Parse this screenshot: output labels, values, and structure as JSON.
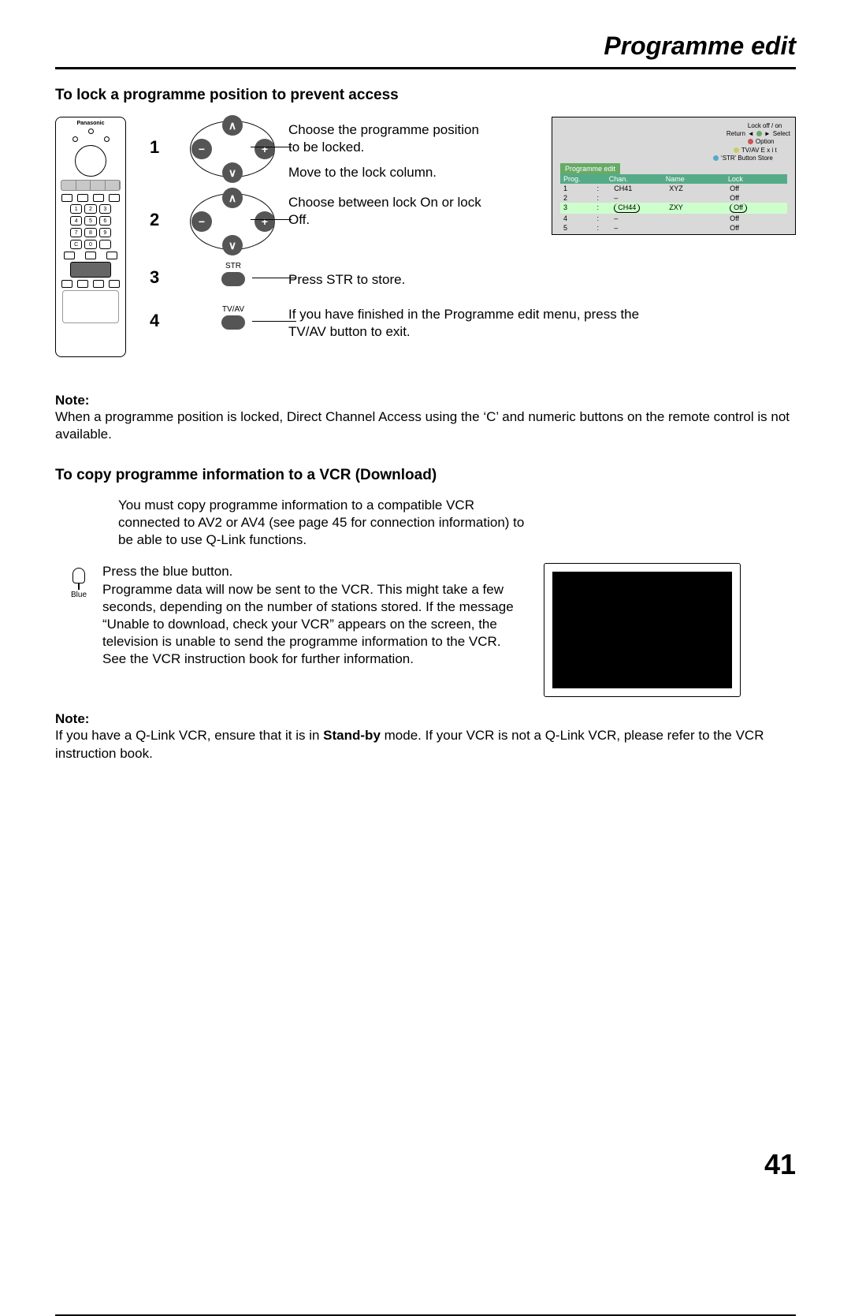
{
  "page_title": "Programme edit",
  "page_number": "41",
  "section1": {
    "title": "To lock a programme position to prevent access",
    "remote_brand": "Panasonic",
    "steps": [
      {
        "num": "1",
        "text1": "Choose the programme position to be locked.",
        "text2": "Move to the lock column."
      },
      {
        "num": "2",
        "text1": "Choose between lock On or lock Off."
      },
      {
        "num": "3",
        "label": "STR",
        "text1": "Press STR to store."
      },
      {
        "num": "4",
        "label": "TV/AV",
        "text1": "If you have finished in the Programme edit menu, press the TV/AV button to exit."
      }
    ],
    "note_label": "Note:",
    "note_text": "When a programme position is locked, Direct Channel Access using the ‘C’ and numeric buttons on the remote control is not available."
  },
  "osd": {
    "menu": {
      "lock": "Lock off / on",
      "select": "Select",
      "return": "Return",
      "option": "Option",
      "exit": "TV/AV    E x i t",
      "store": "‘STR’ Button    Store"
    },
    "tab": "Programme edit",
    "headers": [
      "Prog.",
      "Chan.",
      "Name",
      "Lock"
    ],
    "rows": [
      {
        "cells": [
          "1",
          ":",
          "CH41",
          "XYZ",
          "Off"
        ],
        "sel": false
      },
      {
        "cells": [
          "2",
          ":",
          "–",
          "",
          "Off"
        ],
        "sel": false
      },
      {
        "cells": [
          "3",
          ":",
          "CH44",
          "ZXY",
          "Off"
        ],
        "sel": true
      },
      {
        "cells": [
          "4",
          ":",
          "–",
          "",
          "Off"
        ],
        "sel": false
      },
      {
        "cells": [
          "5",
          ":",
          "–",
          "",
          "Off"
        ],
        "sel": false
      }
    ]
  },
  "section2": {
    "title": "To copy programme information to a VCR (Download)",
    "intro": "You must copy programme information to a compatible VCR connected to AV2 or AV4 (see page 45 for connection information) to be able to use Q-Link functions.",
    "blue_label": "Blue",
    "press_line": "Press the blue button.",
    "body": "Programme data will now be sent to the VCR. This might take a few seconds, depending on the number of stations stored. If the message “Unable to download, check your VCR” appears on the screen, the television is unable to send the programme information to the VCR. See the VCR instruction book for further information.",
    "note_label": "Note:",
    "note_text_pre": "If you have a Q-Link VCR, ensure that it is in ",
    "note_bold": "Stand-by",
    "note_text_post": " mode. If your VCR is not a Q-Link VCR, please refer to the VCR instruction book."
  }
}
